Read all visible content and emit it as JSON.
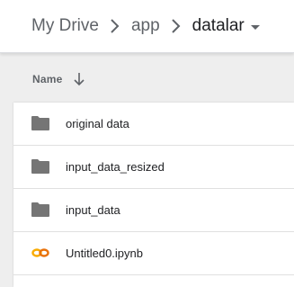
{
  "breadcrumb": {
    "root": "My Drive",
    "parent": "app",
    "current": "datalar"
  },
  "list_header": {
    "name_label": "Name"
  },
  "files": [
    {
      "label": "original data",
      "icon": "folder-icon"
    },
    {
      "label": "input_data_resized",
      "icon": "folder-icon"
    },
    {
      "label": "input_data",
      "icon": "folder-icon"
    },
    {
      "label": "Untitled0.ipynb",
      "icon": "colab-icon"
    }
  ],
  "colors": {
    "folder": "#757575",
    "colab_accent": "#f9ab00",
    "text_primary": "#202124",
    "text_secondary": "#5f6368"
  }
}
